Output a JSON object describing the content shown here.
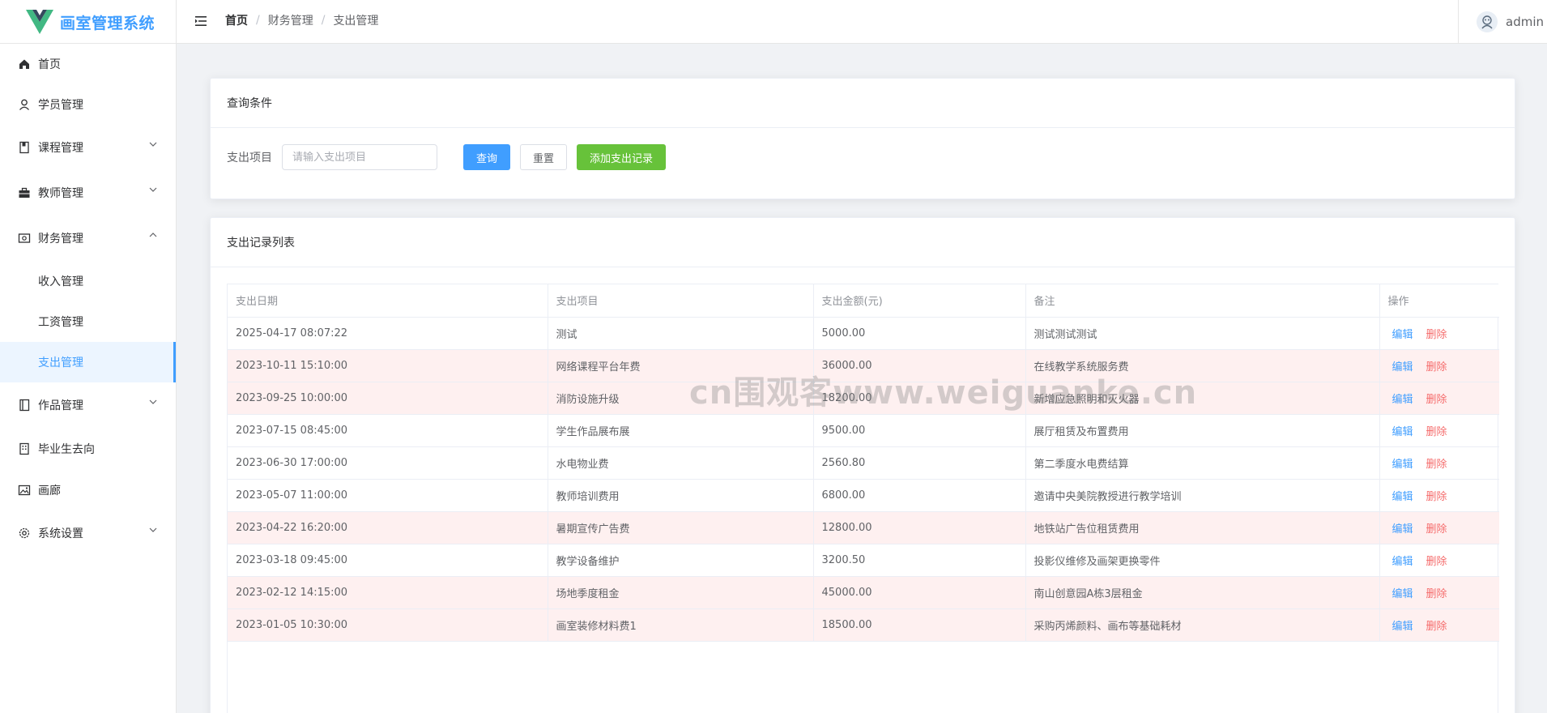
{
  "app": {
    "title": "画室管理系统",
    "username": "admin",
    "brand_color": "#409eff"
  },
  "breadcrumb": [
    "首页",
    "财务管理",
    "支出管理"
  ],
  "sidebar": {
    "items": [
      {
        "label": "首页",
        "icon": "home-icon"
      },
      {
        "label": "学员管理",
        "icon": "user-icon"
      },
      {
        "label": "课程管理",
        "icon": "book-icon",
        "expandable": true
      },
      {
        "label": "教师管理",
        "icon": "briefcase-icon",
        "expandable": true
      },
      {
        "label": "财务管理",
        "icon": "wallet-icon",
        "expandable": true,
        "expanded": true
      },
      {
        "label": "收入管理",
        "sub": true
      },
      {
        "label": "工资管理",
        "sub": true
      },
      {
        "label": "支出管理",
        "sub": true,
        "active": true
      },
      {
        "label": "作品管理",
        "icon": "notebook-icon",
        "expandable": true
      },
      {
        "label": "毕业生去向",
        "icon": "office-building-icon"
      },
      {
        "label": "画廊",
        "icon": "picture-icon"
      },
      {
        "label": "系统设置",
        "icon": "gear-icon",
        "expandable": true
      }
    ]
  },
  "query": {
    "title": "查询条件",
    "field_label": "支出项目",
    "placeholder": "请输入支出项目",
    "search_label": "查询",
    "reset_label": "重置",
    "add_label": "添加支出记录"
  },
  "list": {
    "title": "支出记录列表",
    "columns": [
      "支出日期",
      "支出项目",
      "支出金额(元)",
      "备注",
      "操作"
    ],
    "edit_label": "编辑",
    "delete_label": "删除",
    "rows": [
      {
        "date": "2025-04-17 08:07:22",
        "item": "测试",
        "amount": "5000.00",
        "note": "测试测试测试",
        "highlight": false
      },
      {
        "date": "2023-10-11 15:10:00",
        "item": "网络课程平台年费",
        "amount": "36000.00",
        "note": "在线教学系统服务费",
        "highlight": true
      },
      {
        "date": "2023-09-25 10:00:00",
        "item": "消防设施升级",
        "amount": "18200.00",
        "note": "新增应急照明和灭火器",
        "highlight": true
      },
      {
        "date": "2023-07-15 08:45:00",
        "item": "学生作品展布展",
        "amount": "9500.00",
        "note": "展厅租赁及布置费用",
        "highlight": false
      },
      {
        "date": "2023-06-30 17:00:00",
        "item": "水电物业费",
        "amount": "2560.80",
        "note": "第二季度水电费结算",
        "highlight": false
      },
      {
        "date": "2023-05-07 11:00:00",
        "item": "教师培训费用",
        "amount": "6800.00",
        "note": "邀请中央美院教授进行教学培训",
        "highlight": false
      },
      {
        "date": "2023-04-22 16:20:00",
        "item": "暑期宣传广告费",
        "amount": "12800.00",
        "note": "地铁站广告位租赁费用",
        "highlight": true
      },
      {
        "date": "2023-03-18 09:45:00",
        "item": "教学设备维护",
        "amount": "3200.50",
        "note": "投影仪维修及画架更换零件",
        "highlight": false
      },
      {
        "date": "2023-02-12 14:15:00",
        "item": "场地季度租金",
        "amount": "45000.00",
        "note": "南山创意园A栋3层租金",
        "highlight": true
      },
      {
        "date": "2023-01-05 10:30:00",
        "item": "画室装修材料费1",
        "amount": "18500.00",
        "note": "采购丙烯颜料、画布等基础耗材",
        "highlight": true
      }
    ]
  },
  "watermark": "cn围观客www.weiguanke.cn"
}
